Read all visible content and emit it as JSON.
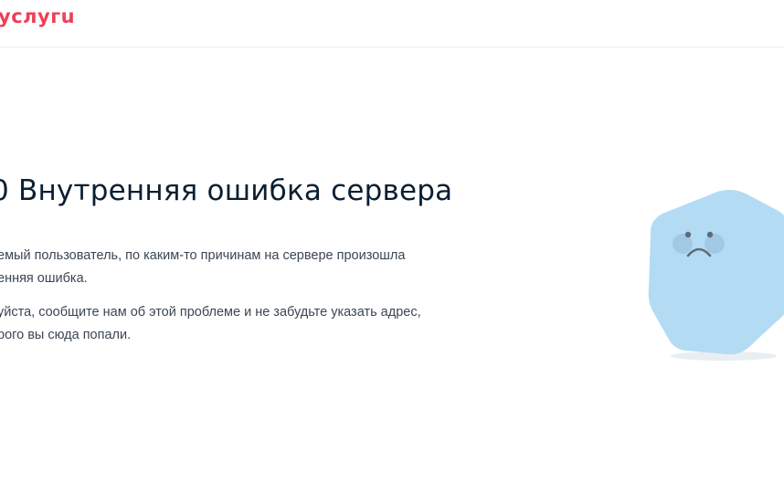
{
  "header": {
    "logo_text": "услугu",
    "brand_color": "#ee3f58"
  },
  "error": {
    "title": "0 Внутренняя ошибка сервера",
    "paragraph_1_line_1": "емый пользователь, по каким-то причинам на сервере произошла",
    "paragraph_1_line_2": "енняя ошибка.",
    "paragraph_2_line_1": "уйста, сообщите нам об этой проблеме и не забудьте указать адрес,",
    "paragraph_2_line_2": "рого вы сюда попали."
  },
  "mascot": {
    "icon": "sad-hexagon-icon",
    "body_color": "#b3dcf4",
    "cheek_color": "#9bc3df",
    "face_color": "#5f6b76",
    "shadow_color": "#e8eef2"
  }
}
